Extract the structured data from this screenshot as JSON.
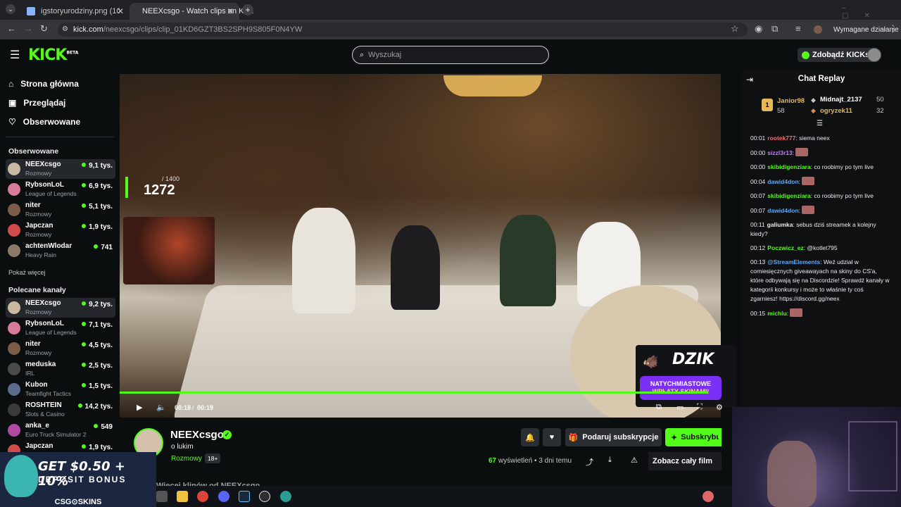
{
  "browser": {
    "tabs": [
      {
        "title": "igstoryurodziny.png (1080×192..."
      },
      {
        "title": "NEEXcsgo - Watch clips on Kick"
      }
    ],
    "url_host": "kick.com",
    "url_path": "/neexcsgo/clips/clip_01KD6GZT3BS2SPH9S805F0N4YW",
    "profile_action": "Wymagane działanie"
  },
  "header": {
    "logo": "KICK",
    "logo_beta": "BETA",
    "search_placeholder": "Wyszukaj",
    "get_kicks": "Zdobądź KICKs"
  },
  "sidebar": {
    "nav": [
      {
        "label": "Strona główna"
      },
      {
        "label": "Przeglądaj"
      },
      {
        "label": "Obserwowane"
      }
    ],
    "followed_heading": "Obserwowane",
    "followed": [
      {
        "name": "NEEXcsgo",
        "category": "Rozmowy",
        "viewers": "9,1 tys.",
        "color": "#c9b8a2"
      },
      {
        "name": "RybsonLoL",
        "category": "League of Legends",
        "viewers": "6,9 tys.",
        "color": "#d77a9c"
      },
      {
        "name": "niter",
        "category": "Rozmowy",
        "viewers": "5,1 tys.",
        "color": "#7a5c48"
      },
      {
        "name": "Japczan",
        "category": "Rozmowy",
        "viewers": "1,9 tys.",
        "color": "#d24a4a"
      },
      {
        "name": "achtenWlodar",
        "category": "Heavy Rain",
        "viewers": "741",
        "color": "#8c7a68"
      }
    ],
    "show_more": "Pokaż więcej",
    "recommended_heading": "Polecane kanały",
    "recommended": [
      {
        "name": "NEEXcsgo",
        "category": "Rozmowy",
        "viewers": "9,2 tys.",
        "color": "#c9b8a2"
      },
      {
        "name": "RybsonLoL",
        "category": "League of Legends",
        "viewers": "7,1 tys.",
        "color": "#d77a9c"
      },
      {
        "name": "niter",
        "category": "Rozmowy",
        "viewers": "4,5 tys.",
        "color": "#7a5c48"
      },
      {
        "name": "meduska",
        "category": "IRL",
        "viewers": "2,5 tys.",
        "color": "#4a4a4a"
      },
      {
        "name": "Kubon",
        "category": "Teamfight Tactics",
        "viewers": "1,5 tys.",
        "color": "#5a6b8c"
      },
      {
        "name": "ROSHTEIN",
        "category": "Slots & Casino",
        "viewers": "14,2 tys.",
        "color": "#3a3a3a"
      },
      {
        "name": "anka_e",
        "category": "Euro Truck Simulator 2",
        "viewers": "549",
        "color": "#b04aa0"
      },
      {
        "name": "Japczan",
        "category": "",
        "viewers": "1,9 tys.",
        "color": "#d24a4a"
      }
    ]
  },
  "player": {
    "counter_max": "/ 1400",
    "counter_value": "1272",
    "time_current": "00:18",
    "time_total": "00:19",
    "overlay_brand": "DZIK",
    "overlay_line1": "NATYCHMIASTOWE",
    "overlay_line2": "WPŁATY SKINAMI!",
    "progress_fraction": 0.95
  },
  "info": {
    "channel": "NEEXcsgo",
    "clip_title": "o lukim",
    "category": "Rozmowy",
    "age_badge": "18+",
    "gift_label": "Podaruj subskrypcje",
    "subscribe_label": "Subskrybuj",
    "views_count": "67",
    "views_word": "wyświetleń",
    "posted": "• 3 dni temu",
    "full_film": "Zobacz cały film",
    "more_clips": "Więcej klipów od NEEXcsgo"
  },
  "chat": {
    "title": "Chat Replay",
    "leaderboard": [
      {
        "name": "Janior98",
        "score": "58"
      },
      {
        "name": "Midnajt_2137",
        "score": "50"
      },
      {
        "name": "ogryzek11",
        "score": "32"
      }
    ],
    "messages": [
      {
        "ts": "00:01",
        "user": "rootek777",
        "color": "#ff6b6b",
        "text": ": siema neex"
      },
      {
        "ts": "00:00",
        "user": "sizzl3r13",
        "color": "#c77dff",
        "text": ":"
      },
      {
        "ts": "00:00",
        "user": "skibidigenziara",
        "color": "#53fc18",
        "text": ": co roobimy po tym live"
      },
      {
        "ts": "00:04",
        "user": "dawid4don",
        "color": "#5aa9ff",
        "text": ":"
      },
      {
        "ts": "00:07",
        "user": "skibidigenziara",
        "color": "#53fc18",
        "text": ": co roobimy po tym live"
      },
      {
        "ts": "00:07",
        "user": "dawid4don",
        "color": "#5aa9ff",
        "text": ":"
      },
      {
        "ts": "00:11",
        "user": "galiumka",
        "color": "#e8eaed",
        "text": ": sebus dziś streamek a kolejny kiedy?"
      },
      {
        "ts": "00:12",
        "user": "Poczwicz_ez",
        "color": "#53fc18",
        "text": ": @kotlet795"
      },
      {
        "ts": "00:13",
        "user": "@StreamElements",
        "color": "#5aa9ff",
        "text": ": Weź udział w comiesięcznych giveawayach na skiny do CS'a, które odbywają się na Discordzie! Sprawdź kanały w kategorii konkursy i może to właśnie ty coś zgarniesz! https://discord.gg/neex"
      },
      {
        "ts": "00:15",
        "user": "michlu",
        "color": "#53fc18",
        "text": ":"
      }
    ]
  },
  "ad": {
    "line1": "GET $0.50 + 10%",
    "line2": "DEPOSIT BONUS",
    "brand": "CSG⊙SKINS"
  }
}
